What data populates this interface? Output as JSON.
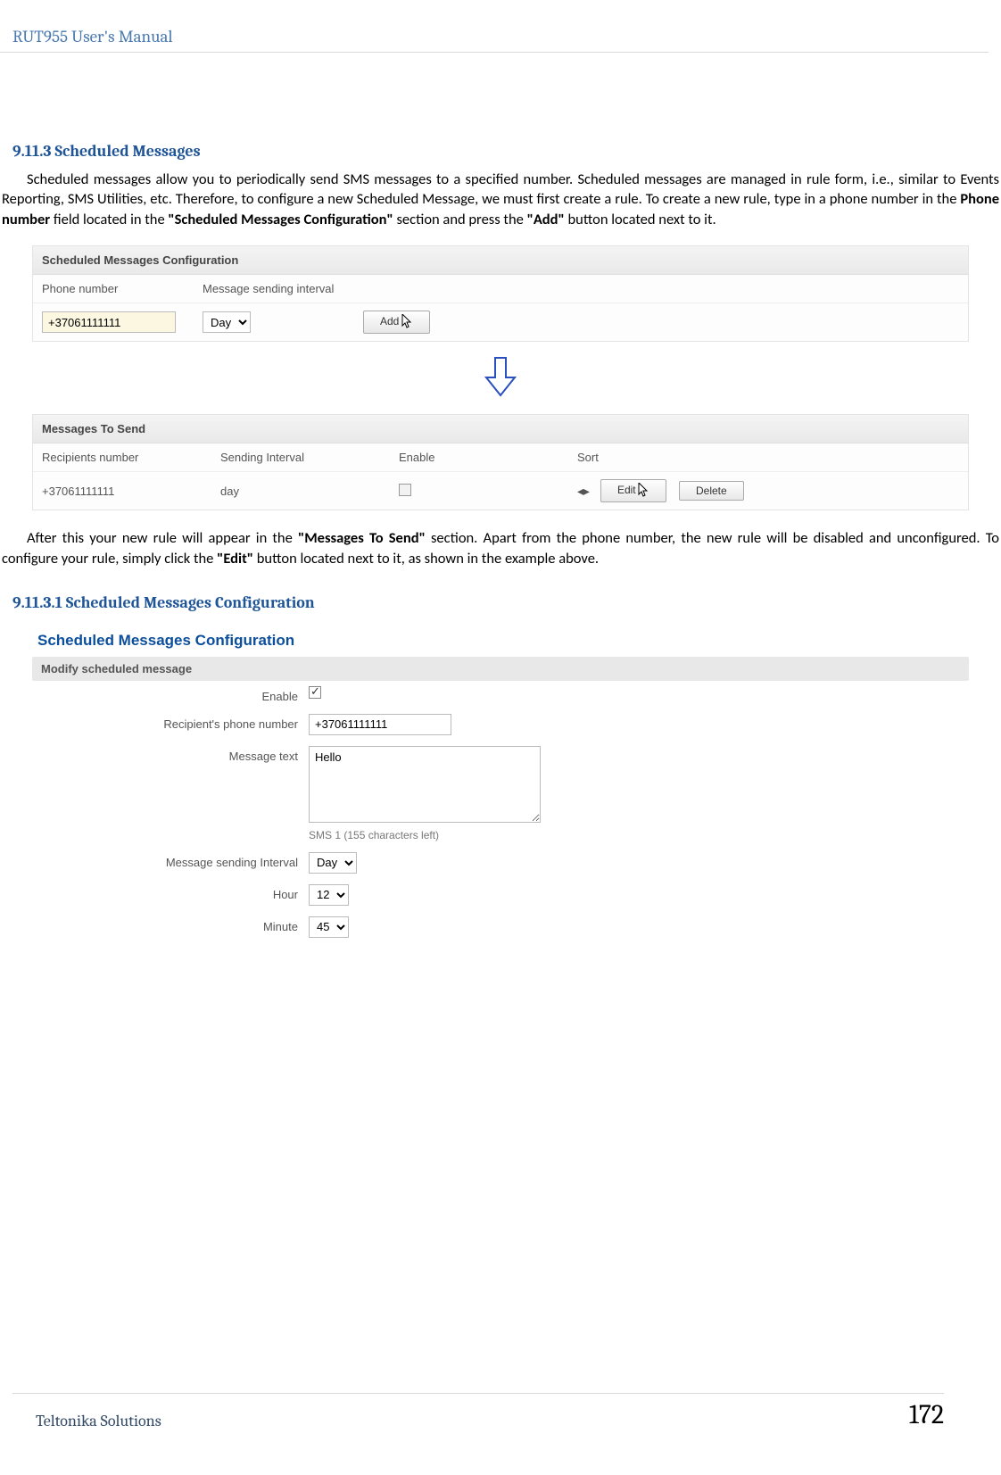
{
  "header_title": "RUT955 User's Manual",
  "section": {
    "num": "9.11.3",
    "title": "Scheduled Messages",
    "para1_prefix": "Scheduled messages allow you to periodically send SMS messages to a specified number. Scheduled messages are managed in rule form, i.e., similar to Events Reporting, SMS Utilities, etc. Therefore, to configure a new Scheduled Message, we must first create a rule. To create a new rule, type in a phone number in the ",
    "para1_bold1": "Phone number",
    "para1_mid1": " field located in the ",
    "para1_bold2": "\"Scheduled Messages Configuration\"",
    "para1_mid2": " section and press the ",
    "para1_bold3": "\"Add\"",
    "para1_suffix": " button located next to it."
  },
  "panel1": {
    "header": "Scheduled Messages Configuration",
    "col_phone": "Phone number",
    "col_interval": "Message sending interval",
    "phone_value": "+37061111111",
    "interval_value": "Day",
    "add_btn": "Add"
  },
  "panel2": {
    "header": "Messages To Send",
    "col_recip": "Recipients number",
    "col_sint": "Sending Interval",
    "col_enable": "Enable",
    "col_sort": "Sort",
    "row_phone": "+37061111111",
    "row_interval": "day",
    "edit_btn": "Edit",
    "delete_btn": "Delete"
  },
  "after_para": {
    "p1_prefix": "After this your new rule will appear in the ",
    "p1_bold1": "\"Messages To Send\"",
    "p1_mid1": " section. Apart from the phone number, the new rule will be disabled and unconfigured. To configure your rule, simply click the ",
    "p1_bold2": "\"Edit\"",
    "p1_suffix": " button located next to it, as shown in the example above."
  },
  "subsection": {
    "num": "9.11.3.1",
    "title": "Scheduled Messages Configuration"
  },
  "config": {
    "title": "Scheduled Messages Configuration",
    "subhead": "Modify scheduled message",
    "enable_label": "Enable",
    "recip_label": "Recipient's phone number",
    "recip_value": "+37061111111",
    "msg_label": "Message text",
    "msg_value": "Hello",
    "sms_hint": "SMS 1 (155 characters left)",
    "interval_label": "Message sending Interval",
    "interval_value": "Day",
    "hour_label": "Hour",
    "hour_value": "12",
    "minute_label": "Minute",
    "minute_value": "45"
  },
  "footer": {
    "company": "Teltonika Solutions",
    "page": "172"
  }
}
